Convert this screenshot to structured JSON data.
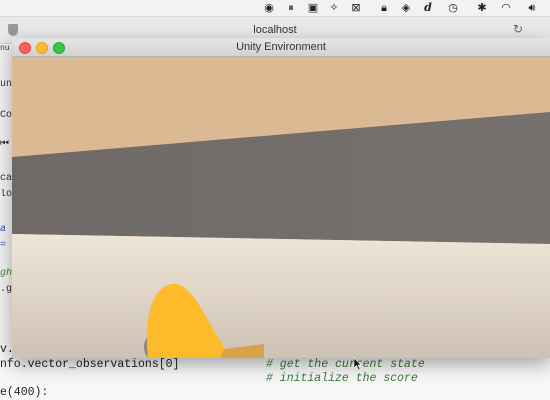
{
  "menubar": {
    "icons": [
      "record-icon",
      "pause-icon",
      "monitor-icon",
      "dropbox-icon",
      "screenshot-icon",
      "lock-icon",
      "script-d-icon",
      "time-machine-icon",
      "bluetooth-icon",
      "wifi-icon",
      "volume-icon"
    ]
  },
  "browser": {
    "address": "localhost"
  },
  "notebook_fragments": [
    {
      "text": "nu",
      "style": "plain"
    },
    {
      "text": "un",
      "style": "plain"
    },
    {
      "text": "Co",
      "style": "plain"
    },
    {
      "text": "ca",
      "style": "plain"
    },
    {
      "text": "lo",
      "style": "plain"
    },
    {
      "text": "a",
      "style": "blue"
    },
    {
      "text": "=",
      "style": "blue"
    },
    {
      "text": "gh",
      "style": "green"
    },
    {
      "text": ".g",
      "style": "plain"
    }
  ],
  "notebook_code": {
    "line1": "v.",
    "line2": "nfo.vector_observations[0]",
    "line3": "e(400):",
    "comment2": "# get the current state",
    "comment3": "# initialize the score"
  },
  "unity": {
    "title": "Unity Environment"
  },
  "colors": {
    "sky": "#dbb992",
    "wall": "#716c69",
    "floor": "#eadfcf",
    "agent": "#fdbb2b"
  }
}
